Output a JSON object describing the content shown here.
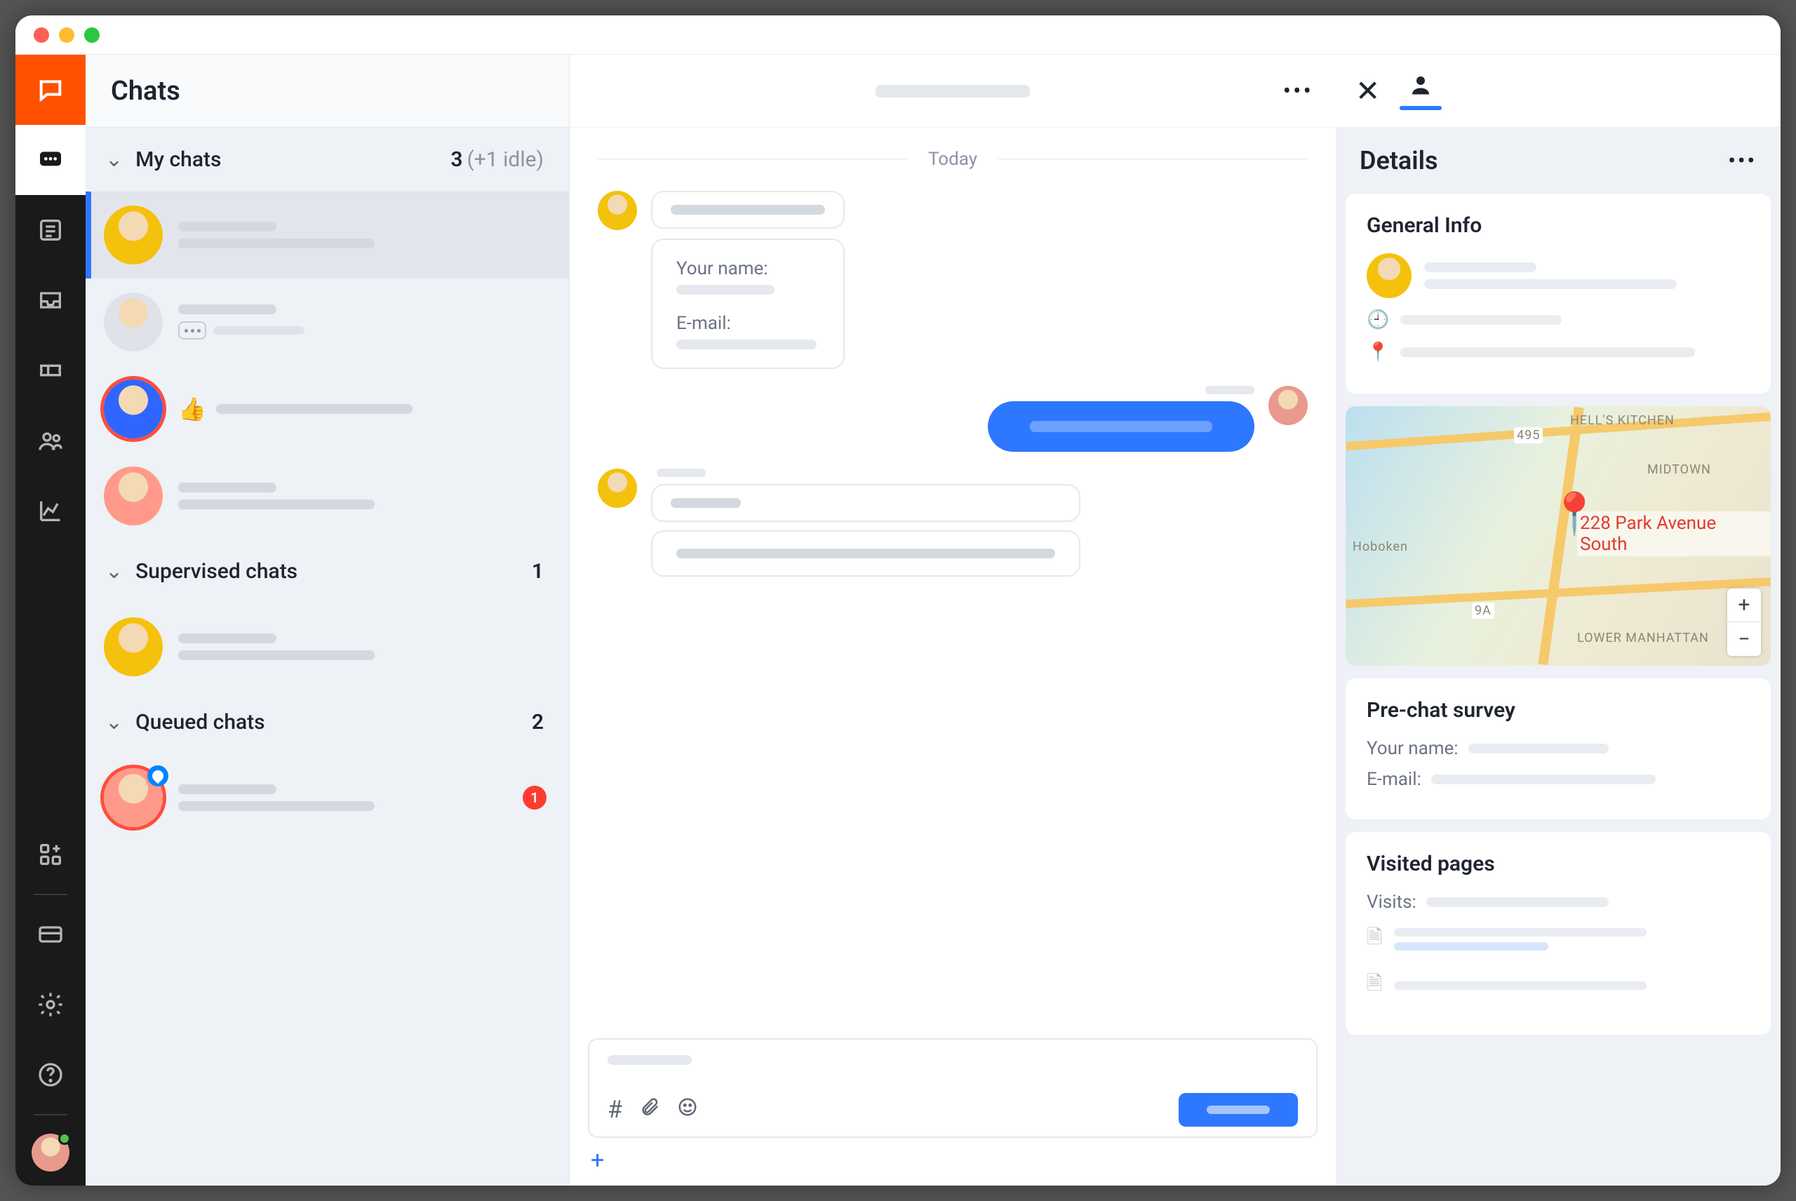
{
  "window": {
    "title_placeholder": ""
  },
  "rail": {
    "items": [
      "brand",
      "chats",
      "list",
      "inbox",
      "ticket",
      "people",
      "analytics"
    ],
    "bottom": [
      "apps",
      "card",
      "settings",
      "help"
    ]
  },
  "chatlist": {
    "header": "Chats",
    "sections": {
      "my": {
        "label": "My chats",
        "count": "3",
        "idle": "(+1 idle)"
      },
      "supervised": {
        "label": "Supervised chats",
        "count": "1"
      },
      "queued": {
        "label": "Queued chats",
        "count": "2"
      }
    },
    "queued_badge": "1"
  },
  "conversation": {
    "day_label": "Today",
    "form": {
      "name_label": "Your name:",
      "email_label": "E-mail:"
    }
  },
  "details": {
    "title": "Details",
    "general": {
      "title": "General Info"
    },
    "map": {
      "address": "228 Park Avenue South",
      "labels": [
        "HELL'S KITCHEN",
        "MIDTOWN",
        "Hoboken",
        "LOWER MANHATTAN",
        "495",
        "9A"
      ]
    },
    "survey": {
      "title": "Pre-chat survey",
      "name_label": "Your name:",
      "email_label": "E-mail:"
    },
    "visited": {
      "title": "Visited pages",
      "visits_label": "Visits:"
    }
  }
}
